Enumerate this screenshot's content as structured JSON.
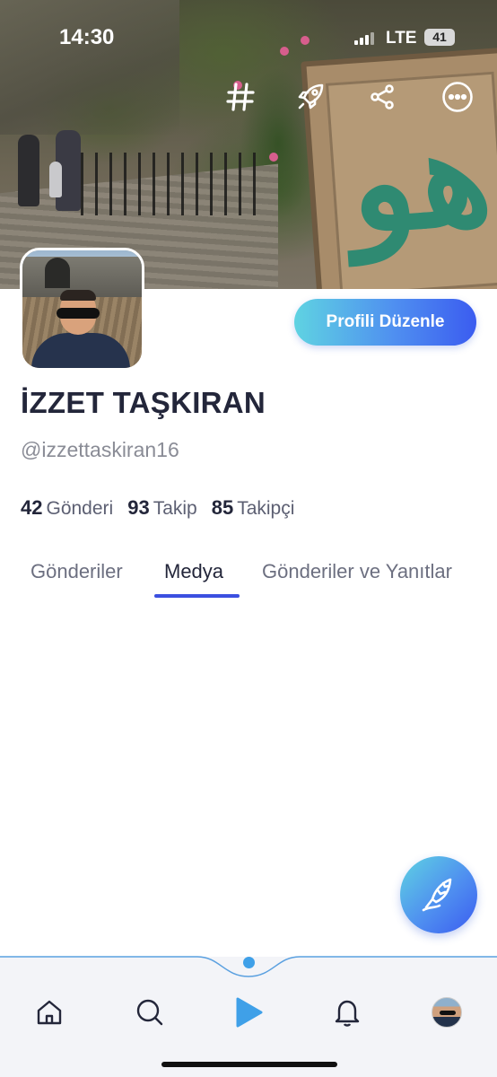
{
  "status_bar": {
    "time": "14:30",
    "network": "LTE",
    "battery": "41"
  },
  "top_actions": [
    "hashtag-icon",
    "rocket-icon",
    "share-icon",
    "more-icon"
  ],
  "profile": {
    "edit_button": "Profili Düzenle",
    "name": "İZZET TAŞKIRAN",
    "handle": "@izzettaskiran16"
  },
  "stats": [
    {
      "count": "42",
      "label": "Gönderi"
    },
    {
      "count": "93",
      "label": "Takip"
    },
    {
      "count": "85",
      "label": "Takipçi"
    }
  ],
  "tabs": [
    {
      "label": "Gönderiler",
      "active": false
    },
    {
      "label": "Medya",
      "active": true
    },
    {
      "label": "Gönderiler ve Yanıtlar",
      "active": false
    }
  ],
  "bottom_nav": [
    "home-icon",
    "search-icon",
    "play-icon",
    "bell-icon",
    "profile-avatar"
  ],
  "colors": {
    "accent": "#3b5cf0",
    "accent_light": "#5fd3e2",
    "text": "#23263a",
    "muted": "#8a8c96"
  }
}
